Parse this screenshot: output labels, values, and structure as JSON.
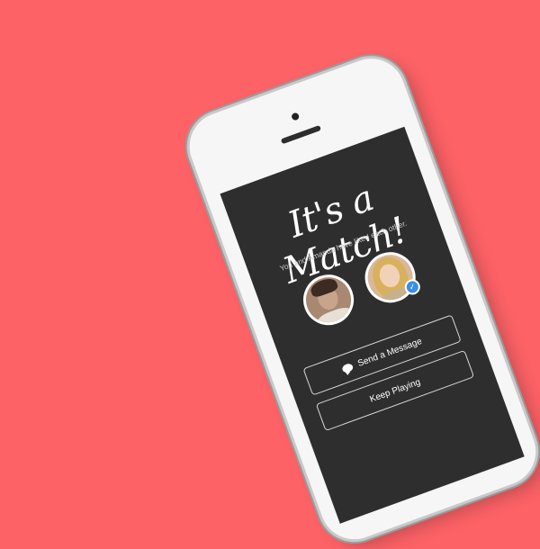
{
  "background_color": "#fc6266",
  "match": {
    "title": "It's a Match!",
    "subtitle": "You and Amanda have liked each other."
  },
  "avatars": {
    "left_icon": "man-profile-photo",
    "right_icon": "woman-profile-photo",
    "verified_icon": "checkmark-badge-icon",
    "verified_glyph": "✓"
  },
  "buttons": {
    "send_message_label": "Send a Message",
    "keep_playing_label": "Keep Playing",
    "message_icon": "chat-bubble-icon"
  }
}
